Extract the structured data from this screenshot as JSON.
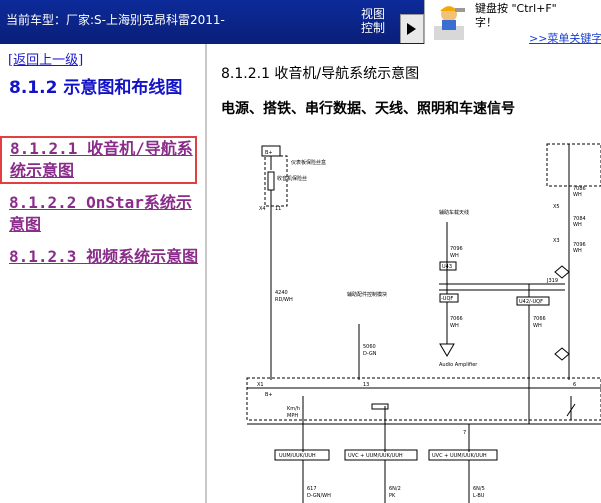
{
  "topbar": {
    "model_label": "当前车型：厂家:S-上海别克昂科雷2011-",
    "view_control": [
      "视图",
      "控制"
    ]
  },
  "help": {
    "line1": "键盘按 \"Ctrl+F\"",
    "line2": "字！",
    "link": ">>菜单关键字"
  },
  "sidebar": {
    "back": "[返回上一级]",
    "title": "8.1.2 示意图和布线图",
    "items": [
      {
        "label": "8.1.2.1 收音机/导航系统示意图",
        "selected": true
      },
      {
        "label": "8.1.2.2 OnStar系统示意图",
        "selected": false
      },
      {
        "label": "8.1.2.3 视频系统示意图",
        "selected": false
      }
    ]
  },
  "content": {
    "heading": "8.1.2.1 收音机/导航系统示意图",
    "subheading": "电源、搭铁、串行数据、天线、照明和车速信号"
  },
  "diagram": {
    "labels": {
      "bplus": "B+",
      "fuse_block": "仪表板保险丝盒",
      "fuse_name": "收音机保险丝",
      "c_x4": "X4",
      "c_11": "11",
      "wire_4240": "4240",
      "wire_4240_color": "RD/WH",
      "antenna_module": "辅助车载天线",
      "wire_7096": "7096",
      "wire_7096_color": "WH",
      "conn_u43": "U43",
      "splice_j319": "J319",
      "uqf": "-UQF",
      "u42_uqf": "U42/-UQF",
      "audio_amp": "Audio Amplifier",
      "wire_7066": "7066",
      "wire_7066_color": "WH",
      "ground_module": "辅助配件控制模块",
      "wire_5060": "5060",
      "wire_5060_color": "D-GN",
      "c_x1": "X1",
      "c_13": "13",
      "c_6": "6",
      "c_7": "7",
      "c_x5": "X5",
      "c_x2": "X2",
      "c_x3": "X3",
      "wire_7086": "7086",
      "wire_7086_color": "WH",
      "wire_7084": "7084",
      "wire_7084_color": "WH",
      "wire_7066b": "7066",
      "wire_7066b_color": "WH",
      "wire_7096b": "7096",
      "wire_7096b_color": "WH",
      "bplus_small": "B+",
      "km_h": "Km/h",
      "mph": "MPH",
      "box1": "UUM/UUK/UUH",
      "box2": "UVC + UUM/UUK/UUH",
      "box3": "UVC + UUM/UUK/UUH",
      "w617": "617",
      "w617_color": "D-GN/WH",
      "w2": "6N/2",
      "w2_color": "PK",
      "w3": "6N/5",
      "w3_color": "L-BU"
    }
  }
}
